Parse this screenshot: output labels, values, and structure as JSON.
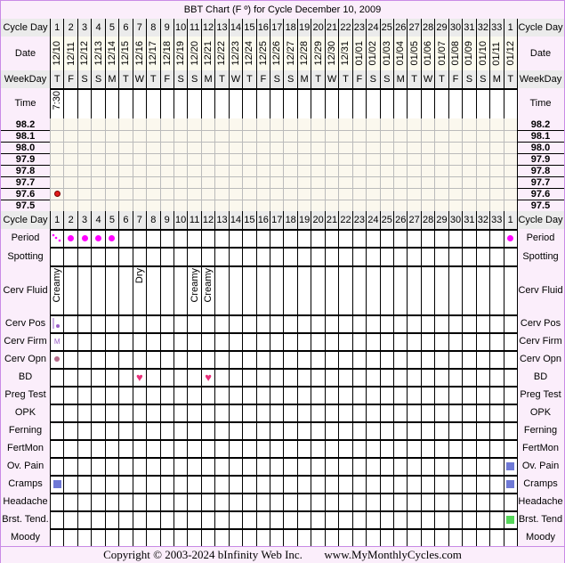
{
  "title": "BBT Chart (F º) for Cycle December 10, 2009",
  "labels": {
    "cycle_day": "Cycle Day",
    "date": "Date",
    "weekday": "WeekDay",
    "time": "Time",
    "period": "Period",
    "spotting": "Spotting",
    "cerv_fluid": "Cerv Fluid",
    "cerv_pos": "Cerv Pos",
    "cerv_firm": "Cerv Firm",
    "cerv_opn": "Cerv Opn",
    "bd": "BD",
    "preg_test": "Preg Test",
    "opk": "OPK",
    "ferning": "Ferning",
    "fertmon": "FertMon",
    "ov_pain": "Ov. Pain",
    "cramps": "Cramps",
    "headache": "Headache",
    "brst_tend_left": "Brst. Tend.",
    "brst_tend_right": "Brst. Tend",
    "moody": "Moody"
  },
  "colors": {
    "label_bg": "#fbeefb",
    "border_accent": "#c98be6",
    "period_dot": "#ff00ff",
    "temp_dot": "#e31b1b",
    "symptom_blue": "#6f79d6",
    "symptom_green": "#55d65a",
    "heart": "#e8307a",
    "cerv_marker": "#9a5fc8",
    "cerv_opn_dot": "#b56b8a"
  },
  "chart_data": {
    "type": "table",
    "title": "BBT Chart (F º) for Cycle December 10, 2009",
    "temp_axis": [
      "98.2",
      "98.1",
      "98.0",
      "97.9",
      "97.8",
      "97.7",
      "97.6",
      "97.5"
    ],
    "ylim": [
      97.5,
      98.2
    ],
    "cycle_days": [
      "1",
      "2",
      "3",
      "4",
      "5",
      "6",
      "7",
      "8",
      "9",
      "10",
      "11",
      "12",
      "13",
      "14",
      "15",
      "16",
      "17",
      "18",
      "19",
      "20",
      "21",
      "22",
      "23",
      "24",
      "25",
      "26",
      "27",
      "28",
      "29",
      "30",
      "31",
      "32",
      "33",
      "1"
    ],
    "dates": [
      "12/10",
      "12/11",
      "12/12",
      "12/13",
      "12/14",
      "12/15",
      "12/16",
      "12/17",
      "12/18",
      "12/19",
      "12/20",
      "12/21",
      "12/22",
      "12/23",
      "12/24",
      "12/25",
      "12/26",
      "12/27",
      "12/28",
      "12/29",
      "12/30",
      "12/31",
      "01/01",
      "01/02",
      "01/03",
      "01/04",
      "01/05",
      "01/06",
      "01/07",
      "01/08",
      "01/09",
      "01/10",
      "01/11",
      "01/12"
    ],
    "weekdays": [
      "T",
      "F",
      "S",
      "S",
      "M",
      "T",
      "W",
      "T",
      "F",
      "S",
      "S",
      "M",
      "T",
      "W",
      "T",
      "F",
      "S",
      "S",
      "M",
      "T",
      "W",
      "T",
      "F",
      "S",
      "S",
      "M",
      "T",
      "W",
      "T",
      "F",
      "S",
      "S",
      "M",
      "T"
    ],
    "times": {
      "0": "7:30"
    },
    "temperatures": [
      {
        "day_index": 0,
        "value": 97.6
      }
    ],
    "period": {
      "0": "spotting-dots",
      "1": "dot",
      "2": "dot",
      "3": "dot",
      "4": "dot",
      "33": "dot"
    },
    "cerv_fluid": {
      "0": "Creamy",
      "6": "Dry",
      "10": "Creamy",
      "11": "Creamy"
    },
    "cerv_pos": {
      "0": "low"
    },
    "cerv_firm": {
      "0": "M"
    },
    "cerv_opn": {
      "0": "dot"
    },
    "bd": [
      6,
      11
    ],
    "ov_pain": [
      33
    ],
    "cramps": [
      0,
      33
    ],
    "brst_tend": [
      33
    ]
  },
  "footer": {
    "copyright": "Copyright © 2003-2024 bInfinity Web Inc.",
    "site": "www.MyMonthlyCycles.com"
  }
}
